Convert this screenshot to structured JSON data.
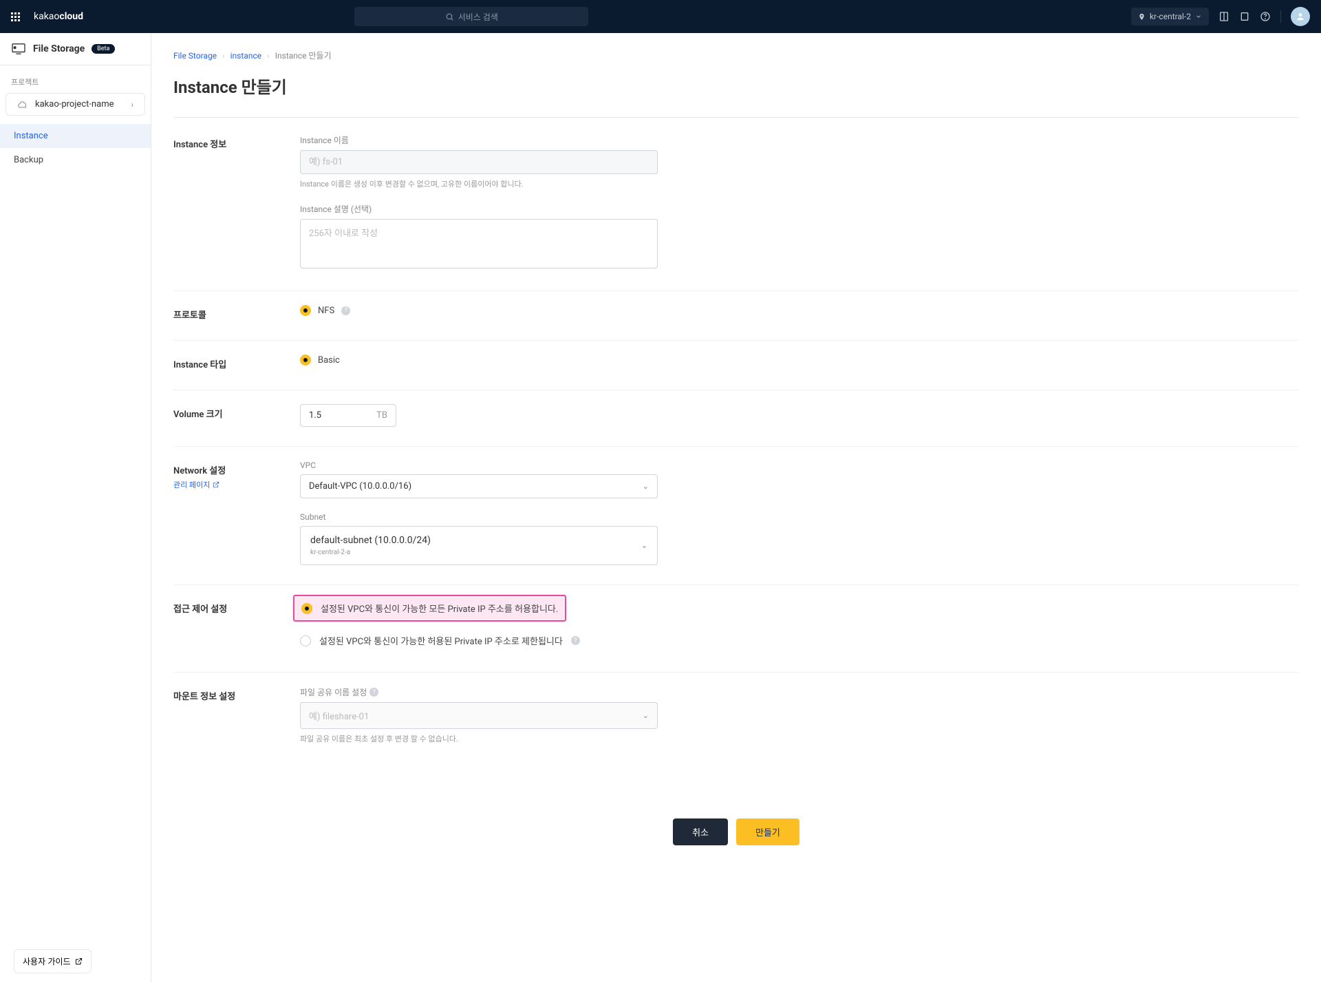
{
  "brand": {
    "prefix": "kakao",
    "suffix": "cloud"
  },
  "search": {
    "placeholder": "서비스 검색"
  },
  "region": {
    "selected": "kr-central-2"
  },
  "service": {
    "name": "File Storage",
    "badge": "Beta"
  },
  "project": {
    "label": "프로젝트",
    "name": "kakao-project-name"
  },
  "nav": {
    "instance": "Instance",
    "backup": "Backup"
  },
  "guide": {
    "label": "사용자 가이드"
  },
  "breadcrumb": {
    "root": "File Storage",
    "parent": "instance",
    "current": "Instance 만들기"
  },
  "page_title": "Instance 만들기",
  "instance_info": {
    "section": "Instance 정보",
    "name_label": "Instance 이름",
    "name_placeholder": "예) fs-01",
    "name_help": "Instance 이름은 생성 이후 변경할 수 없으며, 고유한 이름이어야 합니다.",
    "desc_label": "Instance 설명 (선택)",
    "desc_placeholder": "256자 이내로 작성"
  },
  "protocol": {
    "section": "프로토콜",
    "value": "NFS"
  },
  "instance_type": {
    "section": "Instance 타입",
    "value": "Basic"
  },
  "volume": {
    "section": "Volume 크기",
    "value": "1.5",
    "unit": "TB"
  },
  "network": {
    "section": "Network 설정",
    "manage_link": "관리 페이지",
    "vpc_label": "VPC",
    "vpc_value": "Default-VPC (10.0.0.0/16)",
    "subnet_label": "Subnet",
    "subnet_value": "default-subnet (10.0.0.0/24)",
    "subnet_zone": "kr-central-2-a"
  },
  "access": {
    "section": "접근 제어 설정",
    "option1": "설정된 VPC와 통신이 가능한 모든 Private IP 주소를 허용합니다.",
    "option2": "설정된 VPC와 통신이 가능한 허용된 Private IP 주소로 제한됩니다"
  },
  "mount": {
    "section": "마운트 정보 설정",
    "label": "파일 공유 이름 설정",
    "placeholder": "예) fileshare-01",
    "help": "파일 공유 이름은 최초 설정 후 변경 할 수 없습니다."
  },
  "actions": {
    "cancel": "취소",
    "create": "만들기"
  }
}
